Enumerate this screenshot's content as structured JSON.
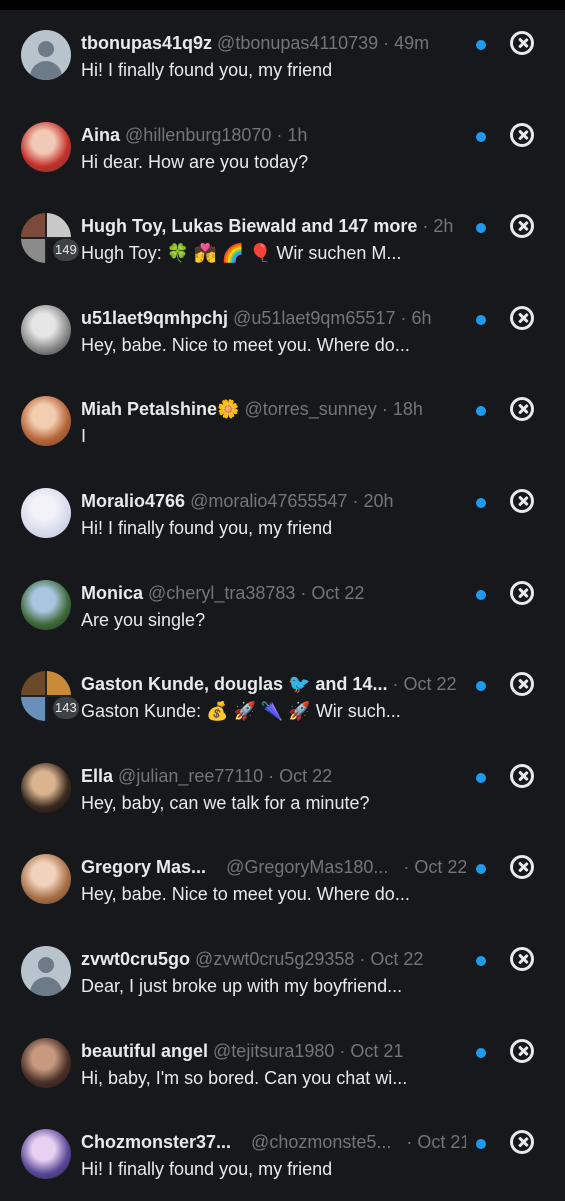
{
  "colors": {
    "background": "#16181c",
    "accent": "#1d9bf0",
    "muted": "#71767b",
    "text": "#e7e9ea"
  },
  "conversations": [
    {
      "name": "tbonupas41q9z",
      "handle": "@tbonupas4110739",
      "time": "49m",
      "preview": "Hi! I finally found you, my friend"
    },
    {
      "name": "Aina",
      "handle": "@hillenburg18070",
      "time": "1h",
      "preview": "Hi dear. How are you today?"
    },
    {
      "name": "Hugh Toy, Lukas Biewald and 147 more",
      "handle": "",
      "time": "2h",
      "preview": "Hugh Toy: 🍀 💏 🌈 🎈 Wir suchen M...",
      "badge": "149"
    },
    {
      "name": "u51laet9qmhpchj",
      "handle": "@u51laet9qm65517",
      "time": "6h",
      "preview": "Hey, babe. Nice to meet you. Where do..."
    },
    {
      "name": "Miah Petalshine🌼",
      "handle": "@torres_sunney",
      "time": "18h",
      "preview": "I"
    },
    {
      "name": "Moralio4766",
      "handle": "@moralio47655547",
      "time": "20h",
      "preview": "Hi! I finally found you, my friend"
    },
    {
      "name": "Monica",
      "handle": "@cheryl_tra38783",
      "time": "Oct 22",
      "preview": "Are you single?"
    },
    {
      "name": "Gaston Kunde, douglas 🐦 and 14...",
      "handle": "",
      "time": "Oct 22",
      "preview": "Gaston Kunde: 💰 🚀 🌂 🚀 Wir such...",
      "badge": "143"
    },
    {
      "name": "Ella",
      "handle": "@julian_ree77110",
      "time": "Oct 22",
      "preview": "Hey, baby, can we talk for a minute?"
    },
    {
      "name": "Gregory Mas...",
      "handle": "@GregoryMas180...",
      "time": "Oct 22",
      "preview": "Hey, babe. Nice to meet you. Where do..."
    },
    {
      "name": "zvwt0cru5go",
      "handle": "@zvwt0cru5g29358",
      "time": "Oct 22",
      "preview": "Dear, I just broke up with my boyfriend..."
    },
    {
      "name": "beautiful angel",
      "handle": "@tejitsura1980",
      "time": "Oct 21",
      "preview": "Hi, baby, I'm so bored. Can you chat wi..."
    },
    {
      "name": "Chozmonster37...",
      "handle": "@chozmonste5...",
      "time": "Oct 21",
      "preview": "Hi! I finally found you, my friend"
    }
  ]
}
